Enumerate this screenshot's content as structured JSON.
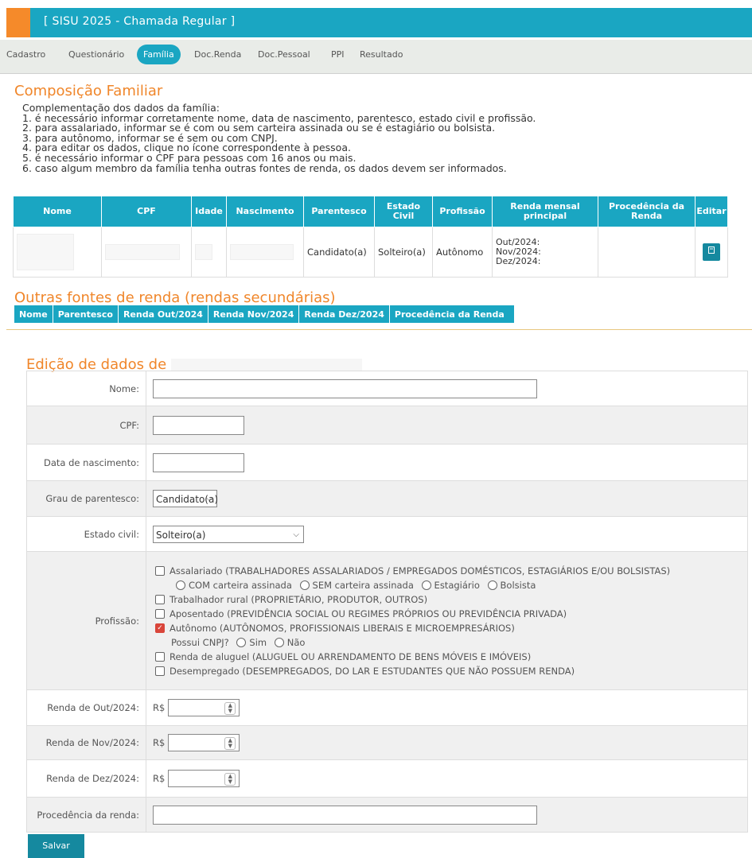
{
  "header": {
    "title": "[ SISU 2025 - Chamada Regular ]"
  },
  "tabs": [
    "Cadastro",
    "Questionário",
    "Família",
    "Doc.Renda",
    "Doc.Pessoal",
    "PPI",
    "Resultado"
  ],
  "composicao": {
    "title": "Composição Familiar",
    "intro": "Complementação dos dados da família:\n1. é necessário informar corretamente nome, data de nascimento, parentesco, estado civil e profissão.\n2. para assalariado, informar se é com ou sem carteira assinada ou se é estagiário ou bolsista.\n3. para autônomo, informar se é sem ou com CNPJ.\n4. para editar os dados, clique no ícone correspondente à pessoa.\n5. é necessário informar o CPF para pessoas com 16 anos ou mais.\n6. caso algum membro da família tenha outras fontes de renda, os dados devem ser informados."
  },
  "family_table": {
    "headers": [
      "Nome",
      "CPF",
      "Idade",
      "Nascimento",
      "Parentesco",
      "Estado Civil",
      "Profissão",
      "Renda mensal principal",
      "Procedência da Renda",
      "Editar"
    ],
    "row": {
      "parentesco": "Candidato(a)",
      "estado_civil": "Solteiro(a)",
      "profissao": "Autônomo",
      "renda_out": "Out/2024:",
      "renda_nov": "Nov/2024:",
      "renda_dez": "Dez/2024:",
      "edit_icon": "edit-icon"
    }
  },
  "outras": {
    "title": "Outras fontes de renda (rendas secundárias)",
    "headers": [
      "Nome",
      "Parentesco",
      "Renda Out/2024",
      "Renda Nov/2024",
      "Renda Dez/2024",
      "Procedência da Renda"
    ]
  },
  "edicao": {
    "title": "Edição de dados de",
    "labels": {
      "nome": "Nome:",
      "cpf": "CPF:",
      "nascimento": "Data de nascimento:",
      "grau": "Grau de parentesco:",
      "estado": "Estado civil:",
      "profissao": "Profissão:",
      "renda_out": "Renda de Out/2024:",
      "renda_nov": "Renda de Nov/2024:",
      "renda_dez": "Renda de Dez/2024:",
      "procedencia": "Procedência da renda:"
    },
    "grau_value": "Candidato(a)",
    "estado_value": "Solteiro(a)",
    "currency": "R$",
    "profissoes": {
      "assalariado": "Assalariado (TRABALHADORES ASSALARIADOS / EMPREGADOS DOMÉSTICOS, ESTAGIÁRIOS E/OU BOLSISTAS)",
      "com_carteira": "COM carteira assinada",
      "sem_carteira": "SEM carteira assinada",
      "estagiario": "Estagiário",
      "bolsista": "Bolsista",
      "rural": "Trabalhador rural (PROPRIETÁRIO, PRODUTOR, OUTROS)",
      "aposentado": "Aposentado (PREVIDÊNCIA SOCIAL OU REGIMES PRÓPRIOS OU PREVIDÊNCIA PRIVADA)",
      "autonomo": "Autônomo (AUTÔNOMOS, PROFISSIONAIS LIBERAIS E MICROEMPRESÁRIOS)",
      "cnpj_q": "Possui CNPJ?",
      "sim": "Sim",
      "nao": "Não",
      "aluguel": "Renda de aluguel (ALUGUEL OU ARRENDAMENTO DE BENS MÓVEIS E IMÓVEIS)",
      "desempregado": "Desempregado (DESEMPREGADOS, DO LAR E ESTUDANTES QUE NÃO POSSUEM RENDA)"
    },
    "save_label": "Salvar"
  },
  "colors": {
    "accent": "#1aa6c2",
    "orange": "#f0862a",
    "checked": "#d9453a"
  }
}
